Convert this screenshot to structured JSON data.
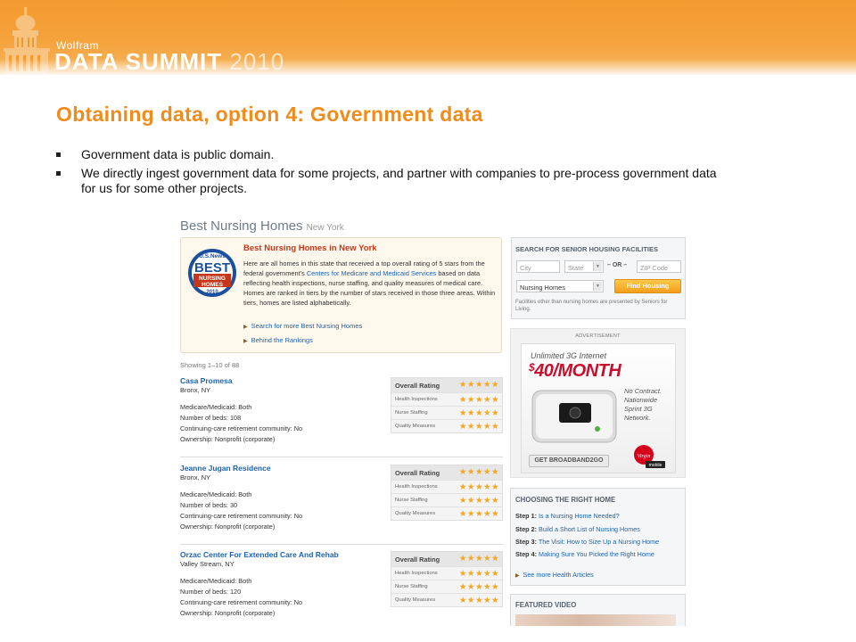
{
  "slide": {
    "brand_top": "Wolfram",
    "brand_main": "DATA SUMMIT",
    "brand_year": "2010",
    "title": "Obtaining data, option 4: Government data",
    "bullets": [
      "Government data is public domain.",
      "We directly ingest government data for some projects, and partner with companies to pre-process government data for us for some other projects."
    ]
  },
  "page": {
    "title": "Best Nursing Homes",
    "location": "New York",
    "intro": {
      "badge_text": [
        "U.S.News",
        "BEST",
        "NURSING",
        "HOMES",
        "2010"
      ],
      "heading": "Best Nursing Homes in New York",
      "text_before_link": "Here are all homes in this state that received a top overall rating of 5 stars from the federal government's ",
      "link": "Centers for Medicare and Medicaid Services",
      "text_after_link": " based on data reflecting health inspections, nurse staffing, and quality measures of medical care. Homes are ranked in tiers by the number of stars received in those three areas. Within tiers, homes are listed alphabetically.",
      "links": [
        "Search for more Best Nursing Homes",
        "Behind the Rankings"
      ]
    },
    "showing": "Showing 1–10 of 88",
    "rating_labels": [
      "Overall Rating",
      "Health Inspections",
      "Nurse Staffing",
      "Quality Measures"
    ],
    "listings": [
      {
        "name": "Casa Promesa",
        "city": "Bronx, NY",
        "details": [
          "Medicare/Medicaid:  Both",
          "Number of beds:  108",
          "Continuing-care retirement community:  No",
          "Ownership:  Nonprofit (corporate)"
        ],
        "stars": [
          5,
          5,
          5,
          5
        ]
      },
      {
        "name": "Jeanne Jugan Residence",
        "city": "Bronx, NY",
        "details": [
          "Medicare/Medicaid:  Both",
          "Number of beds:  30",
          "Continuing-care retirement community:  No",
          "Ownership:  Nonprofit (corporate)"
        ],
        "stars": [
          5,
          5,
          5,
          5
        ]
      },
      {
        "name": "Orzac Center For Extended Care And Rehab",
        "city": "Valley Stream, NY",
        "details": [
          "Medicare/Medicaid:  Both",
          "Number of beds:  120",
          "Continuing-care retirement community:  No",
          "Ownership:  Nonprofit (corporate)"
        ],
        "stars": [
          5,
          5,
          5,
          5
        ]
      }
    ],
    "search": {
      "heading": "SEARCH FOR SENIOR HOUSING FACILITIES",
      "city_placeholder": "City",
      "state_value": "State",
      "or_label": "– OR –",
      "zip_placeholder": "ZIP Code",
      "type_value": "Nursing Homes",
      "button": "Find Housing",
      "note": "Facilities other than nursing homes are presented by Seniors for Living."
    },
    "ad": {
      "label": "ADVERTISEMENT",
      "line1": "Unlimited 3G Internet",
      "price": "40/MONTH",
      "currency": "$",
      "copy": "No Contract. Nationwide Sprint 3G Network.",
      "button": "GET BROADBAND2GO",
      "brand": "Virgin",
      "brand_sub": "mobile"
    },
    "choose": {
      "heading": "CHOOSING THE RIGHT HOME",
      "steps": [
        {
          "step": "Step 1:",
          "text": "Is a Nursing Home Needed?"
        },
        {
          "step": "Step 2:",
          "text": "Build a Short List of Nursing Homes"
        },
        {
          "step": "Step 3:",
          "text": "The Visit: How to Size Up a Nursing Home"
        },
        {
          "step": "Step 4:",
          "text": "Making Sure You Picked the Right Home"
        }
      ],
      "more": "See more Health Articles"
    },
    "featured": {
      "heading": "FEATURED VIDEO"
    },
    "colors": {
      "accent_orange": "#f08c1c",
      "link_blue": "#1a62b3",
      "star_gold": "#f5a623",
      "heading_red": "#c5371a"
    }
  }
}
